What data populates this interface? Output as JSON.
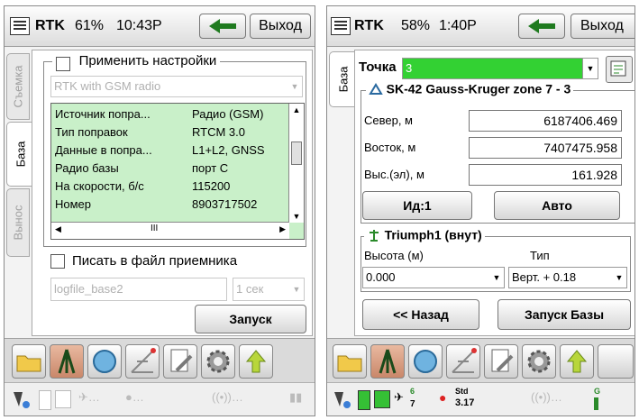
{
  "left": {
    "title": "RTK",
    "battery": "61%",
    "time": "10:43P",
    "exit_label": "Выход",
    "tabs": [
      "Съемка",
      "База",
      "Вынос"
    ],
    "active_tab": "База",
    "apply_settings_label": "Применить настройки",
    "profile_value": "RTK with GSM radio",
    "table_rows": [
      {
        "name": "Источник попра...",
        "value": "Радио (GSM)"
      },
      {
        "name": "Тип поправок",
        "value": "RTCM 3.0"
      },
      {
        "name": "Данные в попра...",
        "value": "L1+L2, GNSS"
      },
      {
        "name": "Радио базы",
        "value": "порт C"
      },
      {
        "name": "На скорости, б/с",
        "value": "115200"
      },
      {
        "name": "Номер",
        "value": "8903717502"
      }
    ],
    "scroll_mid": "III",
    "write_file_label": "Писать в файл приемника",
    "logfile_value": "logfile_base2",
    "interval_value": "1 сек",
    "start_label": "Запуск"
  },
  "right": {
    "title": "RTK",
    "battery": "58%",
    "time": "1:40P",
    "exit_label": "Выход",
    "tab_label": "База",
    "point_label": "Точка",
    "point_value": "3",
    "coord_system": "SK-42 Gauss-Kruger zone 7 - 3",
    "north_label": "Север, м",
    "north_value": "6187406.469",
    "east_label": "Восток, м",
    "east_value": "7407475.958",
    "height_label": "Выс.(эл), м",
    "height_value": "161.928",
    "id_button": "Ид:1",
    "auto_button": "Авто",
    "antenna_title": "Triumph1 (внут)",
    "antenna_height_label": "Высота (м)",
    "antenna_type_label": "Тип",
    "antenna_height_value": "0.000",
    "antenna_type_value": "Верт. + 0.18",
    "back_button": "<< Назад",
    "start_base_button": "Запуск Базы",
    "status_sats": "6",
    "status_sats2": "7",
    "status_std": "Std",
    "status_std_value": "3.17",
    "status_g": "G"
  },
  "colors": {
    "grid_green": "#c9f0c9",
    "point_green": "#33d133",
    "arrow_green": "#1f7a1f"
  }
}
